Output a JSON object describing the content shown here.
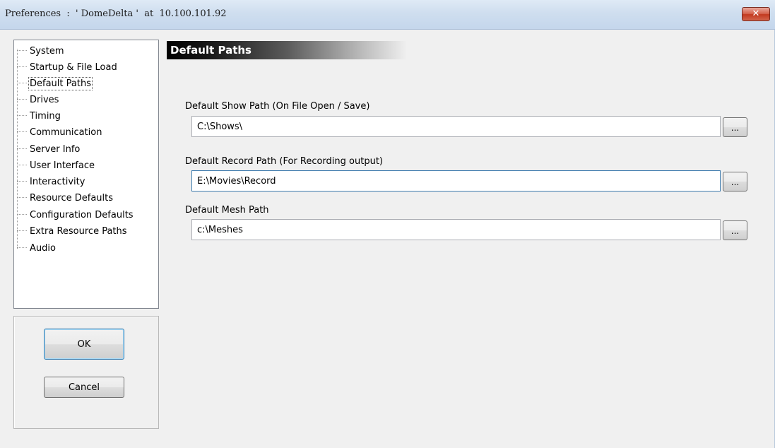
{
  "window": {
    "title": "Preferences  :  ' DomeDelta '  at  10.100.101.92",
    "close_glyph": "✕"
  },
  "nav": {
    "items": [
      {
        "label": "System",
        "selected": false
      },
      {
        "label": "Startup & File Load",
        "selected": false
      },
      {
        "label": "Default Paths",
        "selected": true
      },
      {
        "label": "Drives",
        "selected": false
      },
      {
        "label": "Timing",
        "selected": false
      },
      {
        "label": "Communication",
        "selected": false
      },
      {
        "label": "Server Info",
        "selected": false
      },
      {
        "label": "User Interface",
        "selected": false
      },
      {
        "label": "Interactivity",
        "selected": false
      },
      {
        "label": "Resource Defaults",
        "selected": false
      },
      {
        "label": "Configuration Defaults",
        "selected": false
      },
      {
        "label": "Extra Resource Paths",
        "selected": false
      },
      {
        "label": "Audio",
        "selected": false
      }
    ]
  },
  "buttons": {
    "ok": "OK",
    "cancel": "Cancel"
  },
  "main": {
    "section_title": "Default Paths",
    "show_path": {
      "label": "Default Show Path (On File Open / Save)",
      "value": "C:\\Shows\\",
      "browse": "..."
    },
    "record_path": {
      "label": "Default Record Path (For Recording output)",
      "value": "E:\\Movies\\Record",
      "browse": "..."
    },
    "mesh_path": {
      "label": "Default Mesh Path",
      "value": "c:\\Meshes",
      "browse": "..."
    }
  }
}
